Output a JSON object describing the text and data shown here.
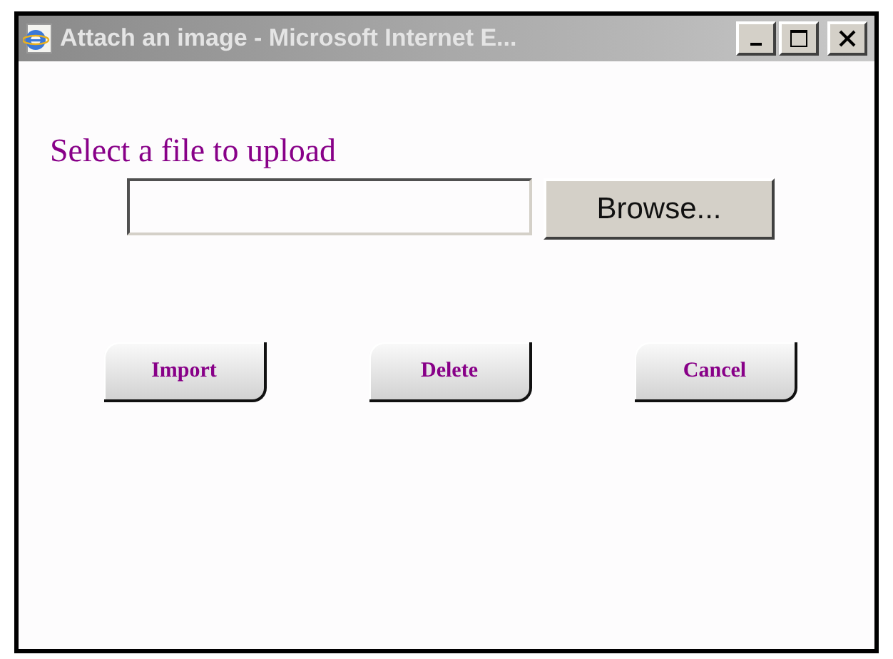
{
  "window": {
    "title": "Attach an image - Microsoft Internet E...",
    "controls": [
      {
        "kind": "minimize"
      },
      {
        "kind": "maximize"
      },
      {
        "kind": "close"
      }
    ]
  },
  "upload": {
    "label": "Select a file to upload",
    "browse": "Browse..."
  },
  "buttons": [
    "Import",
    "Delete",
    "Cancel"
  ]
}
